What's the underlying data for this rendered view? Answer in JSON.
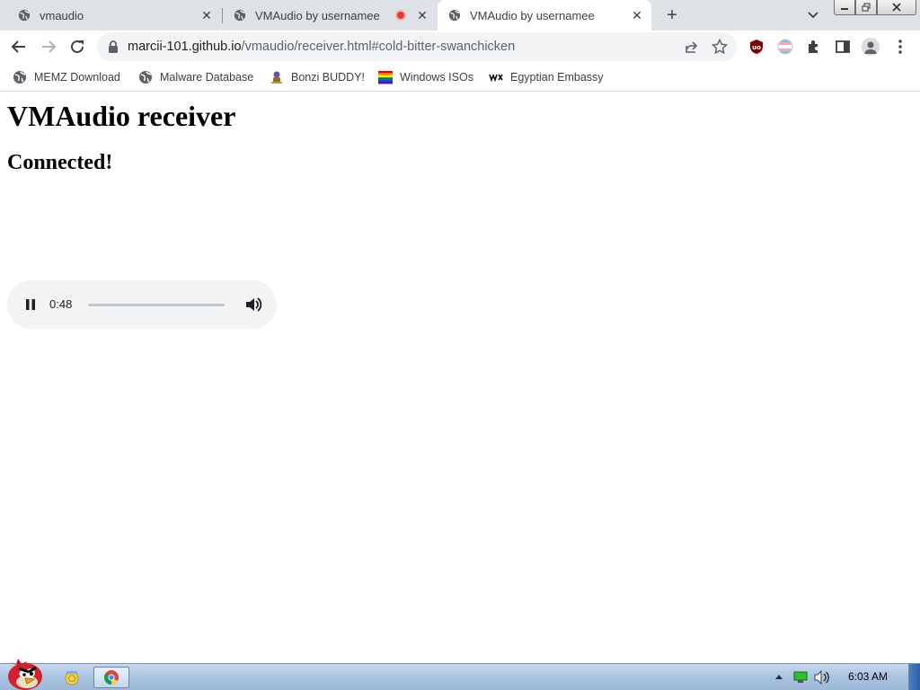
{
  "browser": {
    "tabs": [
      {
        "title": "vmaudio",
        "icon": "globe-icon",
        "recording": false,
        "active": false
      },
      {
        "title": "VMAudio by usernamee",
        "icon": "globe-icon",
        "recording": true,
        "active": false
      },
      {
        "title": "VMAudio by usernamee",
        "icon": "globe-icon",
        "recording": false,
        "active": true
      }
    ],
    "close_glyph": "✕",
    "newtab_glyph": "+",
    "address": {
      "host": "marcii-101.github.io",
      "path": "/vmaudio/receiver.html#cold-bitter-swanchicken"
    },
    "bookmarks": [
      {
        "label": "MEMZ Download",
        "icon": "globe-icon"
      },
      {
        "label": "Malware Database",
        "icon": "globe-icon"
      },
      {
        "label": "Bonzi BUDDY!",
        "icon": "bonzi-icon"
      },
      {
        "label": "Windows ISOs",
        "icon": "rainbow-flag-icon"
      },
      {
        "label": "Egyptian Embassy",
        "icon": "wix-icon"
      }
    ]
  },
  "page": {
    "heading": "VMAudio receiver",
    "status": "Connected!",
    "player": {
      "time": "0:48",
      "state": "playing",
      "progress": 0
    }
  },
  "taskbar": {
    "clock": "6:03 AM"
  },
  "colors": {
    "tabstrip": "#dee1e6",
    "omnibox": "#f1f3f4",
    "player_bg": "#f1f3f4",
    "recording": "#e53935"
  }
}
